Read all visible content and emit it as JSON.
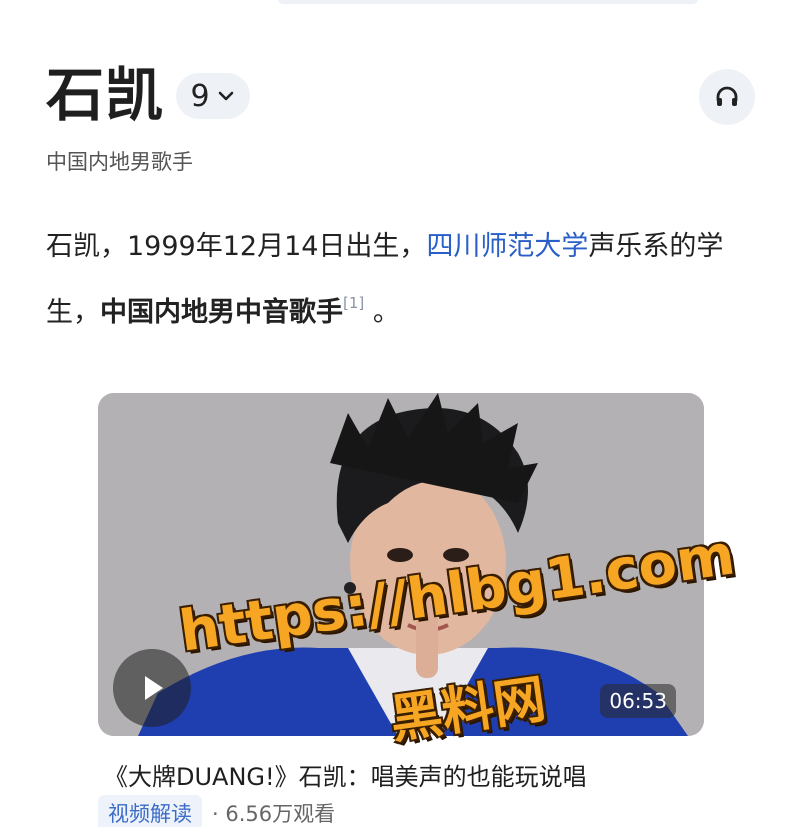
{
  "entry": {
    "title": "石凯",
    "version_count": "9",
    "subtitle": "中国内地男歌手"
  },
  "intro": {
    "part1": "石凯，1999年12月14日出生，",
    "link": "四川师范大学",
    "part2": "声乐系的学生，",
    "bold": "中国内地男中音歌手",
    "ref": "[1]",
    "end": " 。"
  },
  "video": {
    "duration": "06:53",
    "title": "《大牌DUANG!》石凯：唱美声的也能玩说唱",
    "tag": "视频解读",
    "views": "· 6.56万观看"
  },
  "watermark": {
    "line1": "https://hlbg1.com",
    "line2": "黑料网"
  },
  "icons": {
    "version_dropdown": "chevron-down-icon",
    "audio": "headphones-icon",
    "play": "play-icon"
  },
  "colors": {
    "link": "#2a5fc8",
    "pill_bg": "#eef1f6",
    "watermark": "#f6a623"
  }
}
